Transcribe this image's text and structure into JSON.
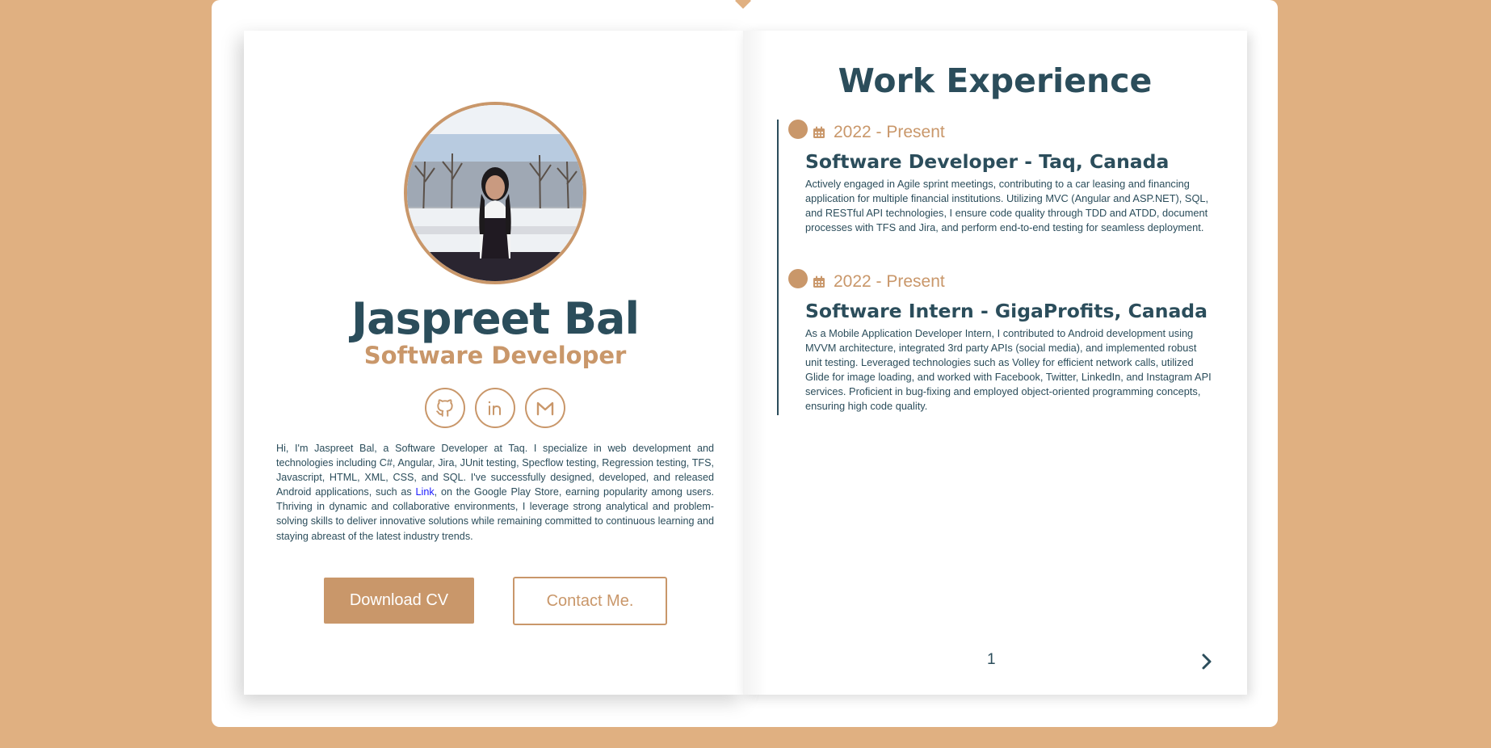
{
  "profile": {
    "photo_alt": "Profile photo",
    "name": "Jaspreet Bal",
    "role": "Software Developer",
    "socials": [
      {
        "name": "github",
        "icon": "github-icon"
      },
      {
        "name": "linkedin",
        "icon": "linkedin-icon"
      },
      {
        "name": "gmail",
        "icon": "mail-icon"
      }
    ],
    "bio_before_link": "Hi, I'm Jaspreet Bal, a Software Developer at Taq. I specialize in web development and technologies including C#, Angular, Jira, JUnit testing, Specflow testing, Regression testing, TFS, Javascript, HTML, XML, CSS, and SQL. I've successfully designed, developed, and released Android applications, such as ",
    "bio_link": "Link",
    "bio_after_link": ", on the Google Play Store, earning popularity among users. Thriving in dynamic and collaborative environments, I leverage strong analytical and problem-solving skills to deliver innovative solutions while remaining committed to continuous learning and staying abreast of the latest industry trends.",
    "download_cv": "Download CV",
    "contact_me": "Contact Me."
  },
  "work": {
    "title": "Work Experience",
    "jobs": [
      {
        "date": "2022 - Present",
        "title": "Software Developer - Taq, Canada",
        "description": "Actively engaged in Agile sprint meetings, contributing to a car leasing and financing application for multiple financial institutions. Utilizing MVC (Angular and ASP.NET), SQL, and RESTful API technologies, I ensure code quality through TDD and ATDD, document processes with TFS and Jira, and perform end-to-end testing for seamless deployment."
      },
      {
        "date": "2022 - Present",
        "title": "Software Intern - GigaProfits, Canada",
        "description": "As a Mobile Application Developer Intern, I contributed to Android development using MVVM architecture, integrated 3rd party APIs (social media), and implemented robust unit testing. Leveraged technologies such as Volley for efficient network calls, utilized Glide for image loading, and worked with Facebook, Twitter, LinkedIn, and Instagram API services. Proficient in bug-fixing and employed object-oriented programming concepts, ensuring high code quality."
      }
    ]
  },
  "pagination": {
    "page": "1",
    "next_icon": "chevron-right-icon"
  },
  "colors": {
    "background": "#e0b081",
    "accent": "#c9976a",
    "text_dark": "#2b4d5b",
    "link": "#1a1aff"
  }
}
